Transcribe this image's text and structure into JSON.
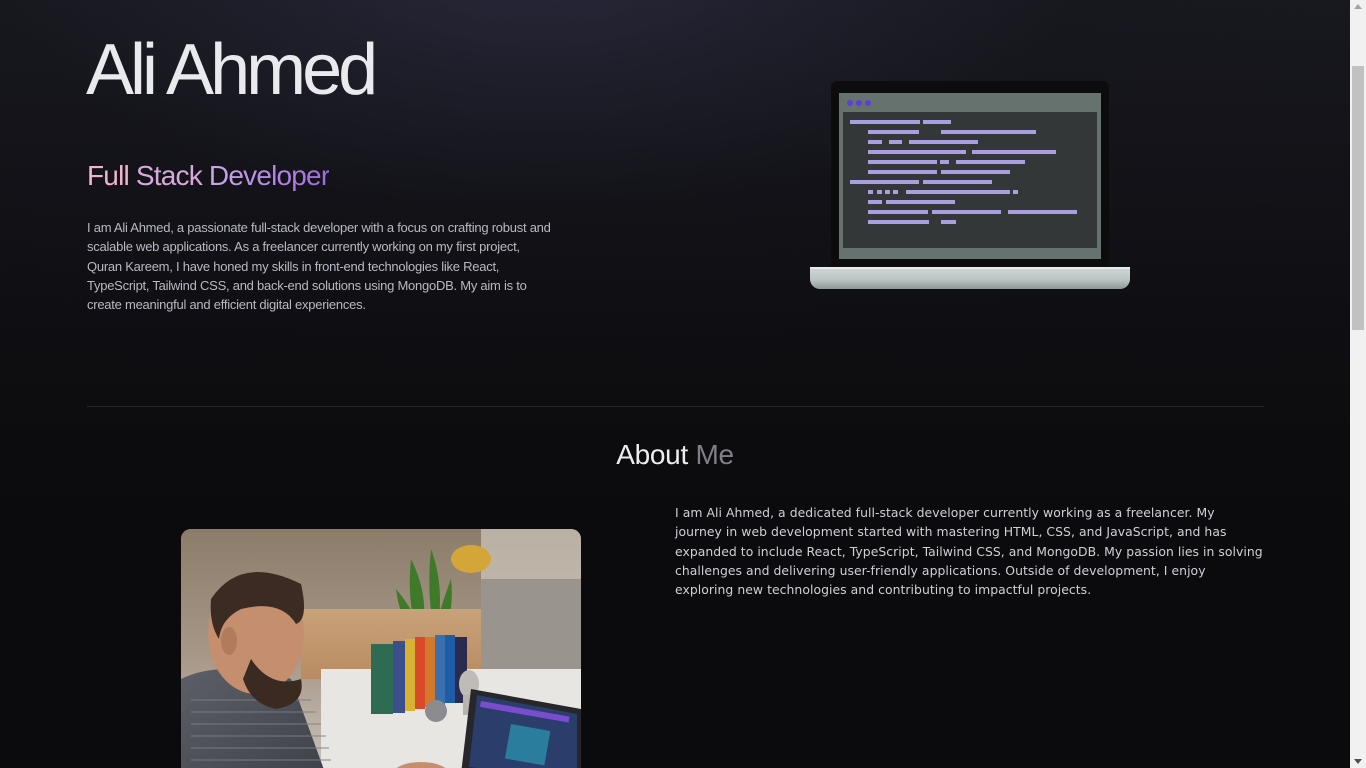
{
  "hero": {
    "name": "Ali Ahmed",
    "role_word_1": "Full",
    "role_word_2": "Stack",
    "role_word_3": "Developer",
    "bio": "I am Ali Ahmed, a passionate full-stack developer with a focus on crafting robust and scalable web applications. As a freelancer currently working on my first project, Quran Kareem, I have honed my skills in front-end technologies like React, TypeScript, Tailwind CSS, and back-end solutions using MongoDB. My aim is to create meaningful and efficient digital experiences."
  },
  "about": {
    "title_part_1": "About",
    "title_part_2": "Me",
    "text": "I am Ali Ahmed, a dedicated full-stack developer currently working as a freelancer. My journey in web development started with mastering HTML, CSS, and JavaScript, and has expanded to include React, TypeScript, Tailwind CSS, and MongoDB. My passion lies in solving challenges and delivering user-friendly applications. Outside of development, I enjoy exploring new technologies and contributing to impactful projects."
  },
  "icons": {
    "hero_illustration": "laptop-code-illustration",
    "about_image": "developer-working-photo"
  },
  "colors": {
    "background": "#0b0b0d",
    "accent_pink": "#f1b3cf",
    "accent_purple": "#a06ae2",
    "code_line": "#a99fe0"
  }
}
